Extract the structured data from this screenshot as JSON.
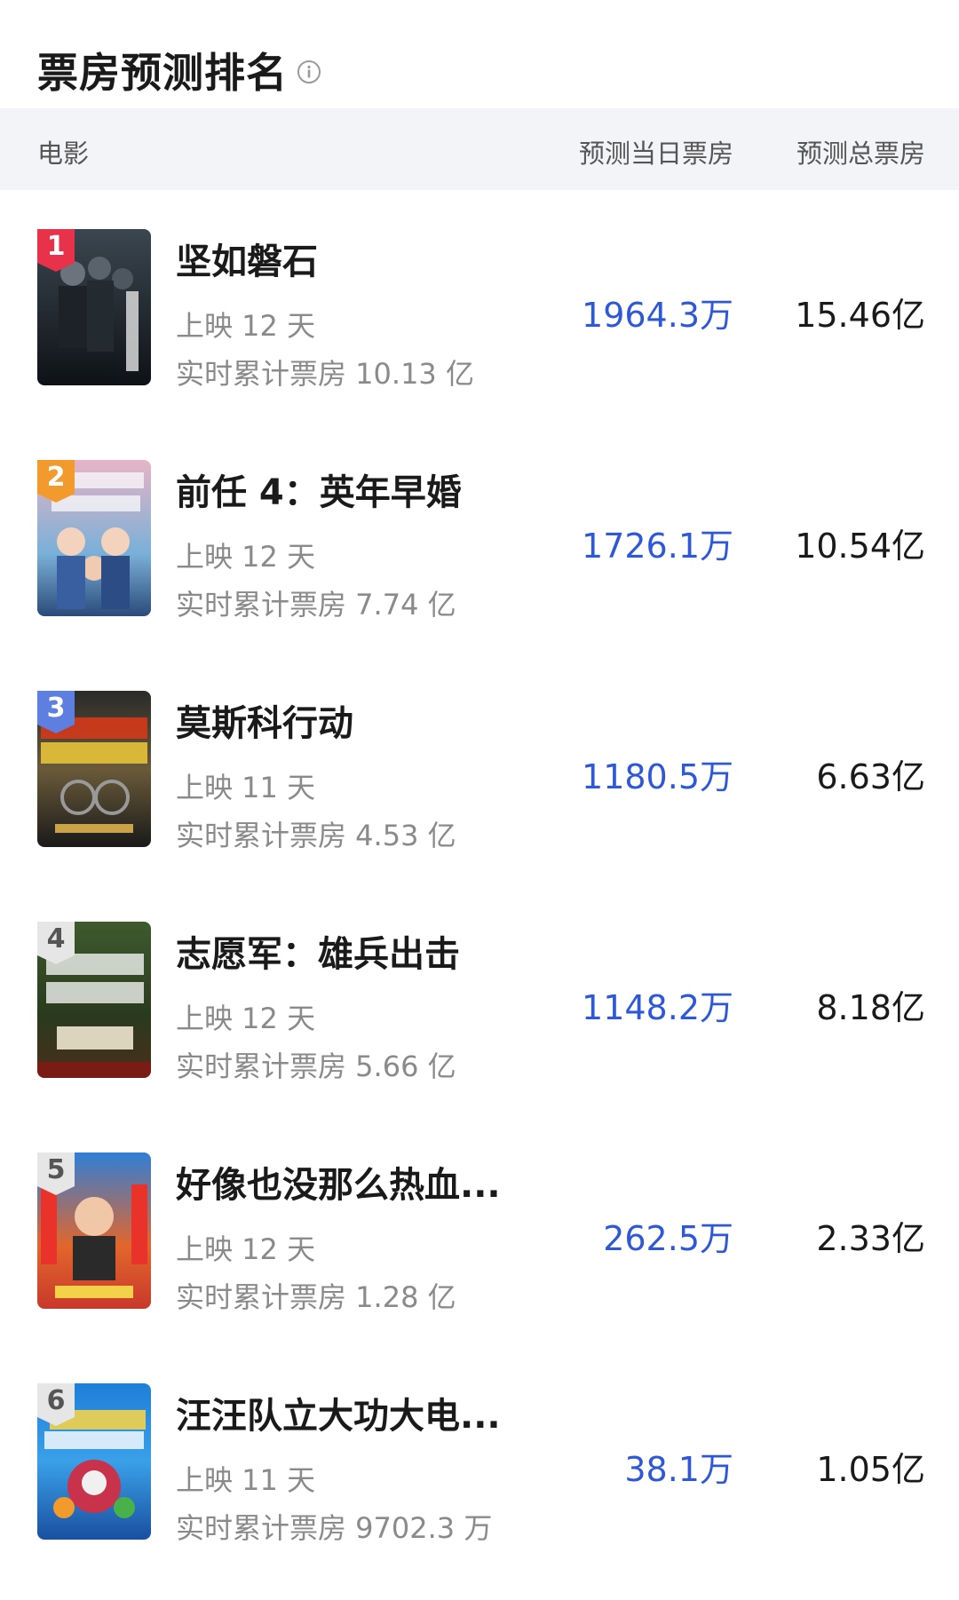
{
  "header": {
    "title": "票房预测排名",
    "info_icon": "info-icon"
  },
  "columns": {
    "movie": "电影",
    "daily": "预测当日票房",
    "total": "预测总票房"
  },
  "colors": {
    "accent_blue": "#2f58d8",
    "rank_red": "#e8324a",
    "rank_orange": "#f39a2c",
    "rank_blue": "#5d7fe0",
    "rank_gray": "#e6e6e6"
  },
  "movies": [
    {
      "rank": "1",
      "title": "坚如磐石",
      "days": "上映 12 天",
      "cumulative": "实时累计票房 10.13 亿",
      "daily": "1964.3万",
      "total": "15.46亿"
    },
    {
      "rank": "2",
      "title": "前任 4：英年早婚",
      "days": "上映 12 天",
      "cumulative": "实时累计票房 7.74 亿",
      "daily": "1726.1万",
      "total": "10.54亿"
    },
    {
      "rank": "3",
      "title": "莫斯科行动",
      "days": "上映 11 天",
      "cumulative": "实时累计票房 4.53 亿",
      "daily": "1180.5万",
      "total": "6.63亿"
    },
    {
      "rank": "4",
      "title": "志愿军：雄兵出击",
      "days": "上映 12 天",
      "cumulative": "实时累计票房 5.66 亿",
      "daily": "1148.2万",
      "total": "8.18亿"
    },
    {
      "rank": "5",
      "title": "好像也没那么热血...",
      "days": "上映 12 天",
      "cumulative": "实时累计票房 1.28 亿",
      "daily": "262.5万",
      "total": "2.33亿"
    },
    {
      "rank": "6",
      "title": "汪汪队立大功大电...",
      "days": "上映 11 天",
      "cumulative": "实时累计票房 9702.3 万",
      "daily": "38.1万",
      "total": "1.05亿"
    }
  ]
}
